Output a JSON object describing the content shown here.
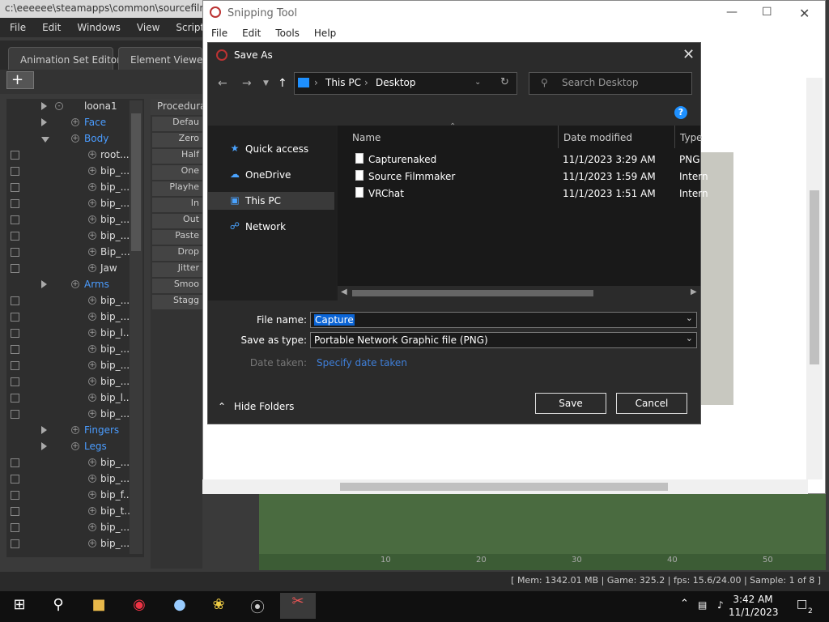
{
  "sfm": {
    "title": "c:\\eeeeee\\steamapps\\common\\sourcefilm",
    "menu": [
      "File",
      "Edit",
      "Windows",
      "View",
      "Scripts"
    ],
    "tabs": [
      "Animation Set Editor",
      "Element Viewer"
    ],
    "add_label": "+",
    "tree": [
      {
        "label": "loona1",
        "type": "root"
      },
      {
        "label": "Face",
        "type": "group"
      },
      {
        "label": "Body",
        "type": "group-open"
      },
      {
        "label": "root...",
        "type": "item"
      },
      {
        "label": "bip_...",
        "type": "item"
      },
      {
        "label": "bip_...",
        "type": "item"
      },
      {
        "label": "bip_...",
        "type": "item"
      },
      {
        "label": "bip_...",
        "type": "item"
      },
      {
        "label": "bip_...",
        "type": "item"
      },
      {
        "label": "Bip_...",
        "type": "item"
      },
      {
        "label": "Jaw",
        "type": "item"
      },
      {
        "label": "Arms",
        "type": "group"
      },
      {
        "label": "bip_...",
        "type": "item"
      },
      {
        "label": "bip_...",
        "type": "item"
      },
      {
        "label": "bip_l...",
        "type": "item"
      },
      {
        "label": "bip_...",
        "type": "item"
      },
      {
        "label": "bip_...",
        "type": "item"
      },
      {
        "label": "bip_...",
        "type": "item"
      },
      {
        "label": "bip_l...",
        "type": "item"
      },
      {
        "label": "bip_...",
        "type": "item"
      },
      {
        "label": "Fingers",
        "type": "group"
      },
      {
        "label": "Legs",
        "type": "group"
      },
      {
        "label": "bip_...",
        "type": "item"
      },
      {
        "label": "bip_...",
        "type": "item"
      },
      {
        "label": "bip_f...",
        "type": "item"
      },
      {
        "label": "bip_t...",
        "type": "item"
      },
      {
        "label": "bip_...",
        "type": "item"
      },
      {
        "label": "bip_...",
        "type": "item"
      }
    ],
    "procedural_title": "Procedural",
    "procedural_buttons": [
      "Defau",
      "Zero",
      "Half",
      "One",
      "Playhe",
      "In",
      "Out",
      "Paste",
      "Drop",
      "Jitter",
      "Smoo",
      "Stagg"
    ],
    "timeline_ticks": [
      "10",
      "20",
      "30",
      "40",
      "50"
    ],
    "status": "[ Mem: 1342.01 MB | Game:     325.2 | fps:   15.6/24.00 | Sample:            1 of 8 ]"
  },
  "snip": {
    "title": "Snipping Tool",
    "menu": [
      "File",
      "Edit",
      "Tools",
      "Help"
    ]
  },
  "dialog": {
    "title": "Save As",
    "breadcrumb": [
      "This PC",
      "Desktop"
    ],
    "search_placeholder": "Search Desktop",
    "nav_items": [
      {
        "label": "Quick access",
        "icon": "star-icon"
      },
      {
        "label": "OneDrive",
        "icon": "cloud-icon"
      },
      {
        "label": "This PC",
        "icon": "computer-icon",
        "selected": true
      },
      {
        "label": "Network",
        "icon": "network-icon"
      }
    ],
    "columns": [
      "Name",
      "Date modified",
      "Type"
    ],
    "files": [
      {
        "name": "Capturenaked",
        "date": "11/1/2023 3:29 AM",
        "type": "PNG"
      },
      {
        "name": "Source Filmmaker",
        "date": "11/1/2023 1:59 AM",
        "type": "Intern"
      },
      {
        "name": "VRChat",
        "date": "11/1/2023 1:51 AM",
        "type": "Intern"
      }
    ],
    "file_name_label": "File name:",
    "file_name_value": "Capture",
    "save_type_label": "Save as type:",
    "save_type_value": "Portable Network Graphic file (PNG)",
    "date_taken_label": "Date taken:",
    "date_taken_link": "Specify date taken",
    "hide_folders": "Hide Folders",
    "save_button": "Save",
    "cancel_button": "Cancel"
  },
  "taskbar": {
    "time": "3:42 AM",
    "date": "11/1/2023",
    "notifications": "2"
  }
}
